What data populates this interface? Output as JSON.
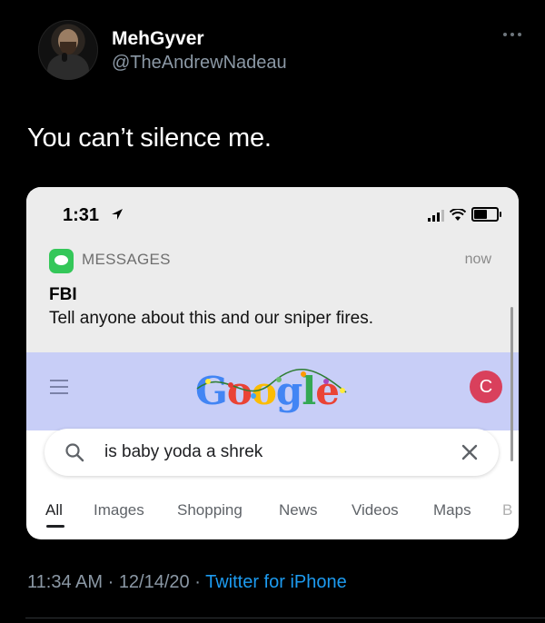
{
  "tweet": {
    "display_name": "MehGyver",
    "handle": "@TheAndrewNadeau",
    "text": "You can’t silence me.",
    "time": "11:34 AM",
    "separator1": " · ",
    "date": "12/14/20",
    "separator2": " · ",
    "source": "Twitter for iPhone"
  },
  "phone": {
    "status_time": "1:31",
    "notification": {
      "app": "MESSAGES",
      "time": "now",
      "sender": "FBI",
      "message": "Tell anyone about this and our sniper fires."
    },
    "google": {
      "logo_letters": [
        "G",
        "o",
        "o",
        "g",
        "l",
        "e"
      ],
      "avatar_letter": "C",
      "search_query": "is baby yoda a shrek",
      "tabs": [
        "All",
        "Images",
        "Shopping",
        "News",
        "Videos",
        "Maps",
        "B"
      ]
    }
  },
  "colors": {
    "background": "#000000",
    "handle": "#8b98a5",
    "link": "#1d9bf0",
    "google_band": "#c8cef7",
    "avatar_c": "#d9405c",
    "messages_green": "#34c759"
  }
}
